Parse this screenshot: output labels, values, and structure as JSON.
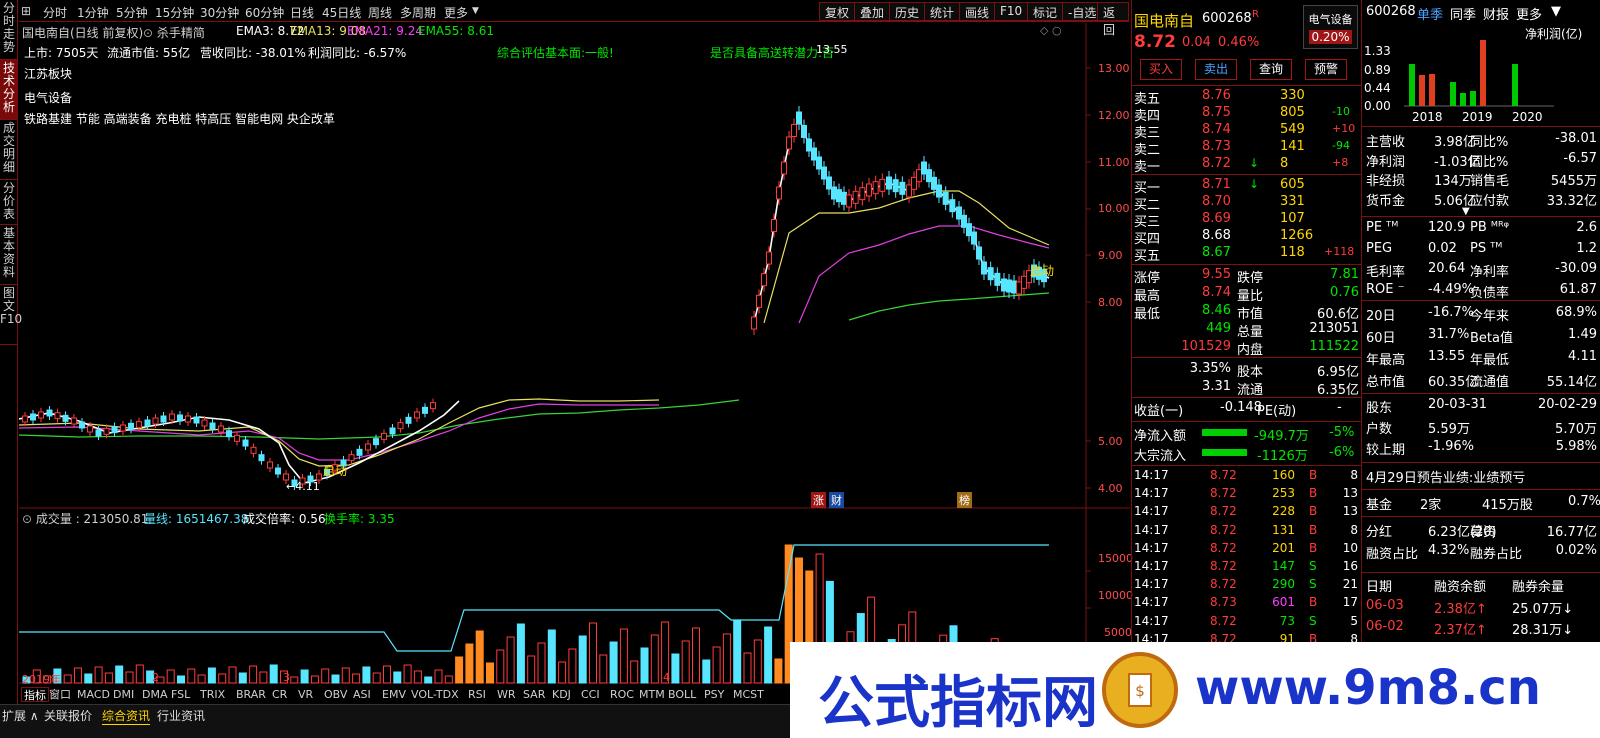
{
  "sidebar": {
    "tabs": [
      "分时走势",
      "技术分析",
      "成交明细",
      "分价表",
      "基本资料",
      "图文F10"
    ]
  },
  "toolbar": {
    "items": [
      "分时",
      "1分钟",
      "5分钟",
      "15分钟",
      "30分钟",
      "60分钟",
      "日线",
      "45日线",
      "周线",
      "多周期",
      "更多"
    ],
    "right": [
      "复权",
      "叠加",
      "历史",
      "统计",
      "画线",
      "F10",
      "标记",
      "-自选",
      "返回"
    ]
  },
  "chart": {
    "title": "国电南自(日线 前复权)",
    "indicator": "杀手精简",
    "ema3": "EMA3: 8.72",
    "ema13": "EMA13: 9.08",
    "ema21": "EMA21: 9.24",
    "ema55": "EMA55: 8.61",
    "listing": "上市: 7505天",
    "mcap": "流通市值: 55亿",
    "rev": "营收同比: -38.01%",
    "profit": "利润同比: -6.57%",
    "fund_eval": "综合评估基本面:一般!",
    "transfer_q": "是否具备高送转潜力:否",
    "blocks": [
      "江苏板块",
      "电气设备",
      "铁路基建 节能 高端装备 充电桩 特高压 智能电网 央企改革"
    ],
    "high_mark": "13.55",
    "low_mark": "4.11",
    "start1": "启动",
    "start2": "启动",
    "yticks": [
      "13.00",
      "12.00",
      "11.00",
      "10.00",
      "9.00",
      "8.00",
      "5.00",
      "4.00"
    ],
    "event_labels": [
      "涨",
      "财",
      "榜"
    ],
    "vol_title": "成交量 : 213050.81",
    "vol_ma": "量线: 1651467.38",
    "vol_ratio": "成交倍率: 0.56",
    "turnover": "换手率: 3.35",
    "vol_yticks": [
      "15000",
      "10000",
      "5000"
    ],
    "xlabels": [
      "2019年",
      "2",
      "3",
      "4"
    ]
  },
  "quote": {
    "name": "国电南自",
    "code": "600268",
    "flag": "R",
    "sector": "电气设备",
    "sector_chg": "0.20%",
    "price": "8.72",
    "chg": "0.04",
    "pct": "0.46%",
    "buttons": [
      "买入",
      "卖出",
      "查询",
      "预警"
    ],
    "asks": [
      {
        "l": "卖五",
        "p": "8.76",
        "v": "330",
        "d": ""
      },
      {
        "l": "卖四",
        "p": "8.75",
        "v": "805",
        "d": "-10"
      },
      {
        "l": "卖三",
        "p": "8.74",
        "v": "549",
        "d": "+10"
      },
      {
        "l": "卖二",
        "p": "8.73",
        "v": "141",
        "d": "-94"
      },
      {
        "l": "卖一",
        "p": "8.72",
        "v": "8",
        "d": "+8"
      }
    ],
    "bids": [
      {
        "l": "买一",
        "p": "8.71",
        "v": "605",
        "d": ""
      },
      {
        "l": "买二",
        "p": "8.70",
        "v": "331",
        "d": ""
      },
      {
        "l": "买三",
        "p": "8.69",
        "v": "107",
        "d": ""
      },
      {
        "l": "买四",
        "p": "8.68",
        "v": "1266",
        "d": ""
      },
      {
        "l": "买五",
        "p": "8.67",
        "v": "118",
        "d": "+118"
      }
    ],
    "stats": [
      [
        "涨停",
        "9.55",
        "跌停",
        "7.81"
      ],
      [
        "最高",
        "8.74",
        "量比",
        "0.76"
      ],
      [
        "最低",
        "8.46",
        "市值",
        "60.6亿"
      ],
      [
        "",
        "449",
        "总量",
        "213051"
      ],
      [
        "",
        "101529",
        "内盘",
        "111522"
      ]
    ],
    "stats2": [
      [
        "",
        "3.35%",
        "股本",
        "6.95亿"
      ],
      [
        "",
        "3.31",
        "流通",
        "6.35亿"
      ]
    ],
    "eps": [
      "收益(一)",
      "-0.148",
      "PE(动)",
      "-"
    ],
    "flows": [
      {
        "l": "净流入额",
        "v": "-949.7万",
        "p": "-5%"
      },
      {
        "l": "大宗流入",
        "v": "-1126万",
        "p": "-6%"
      }
    ],
    "ticks": [
      [
        "14:17",
        "8.72",
        "160",
        "B",
        "8"
      ],
      [
        "14:17",
        "8.72",
        "253",
        "B",
        "13"
      ],
      [
        "14:17",
        "8.72",
        "228",
        "B",
        "13"
      ],
      [
        "14:17",
        "8.72",
        "131",
        "B",
        "8"
      ],
      [
        "14:17",
        "8.72",
        "201",
        "B",
        "10"
      ],
      [
        "14:17",
        "8.72",
        "147",
        "S",
        "16"
      ],
      [
        "14:17",
        "8.72",
        "290",
        "S",
        "21"
      ],
      [
        "14:17",
        "8.73",
        "601",
        "B",
        "17"
      ],
      [
        "14:17",
        "8.72",
        "73",
        "S",
        "5"
      ],
      [
        "14:17",
        "8.72",
        "91",
        "B",
        "8"
      ]
    ]
  },
  "fund": {
    "code": "600268",
    "tabs": [
      "单季",
      "同季",
      "财报",
      "更多"
    ],
    "chart_title": "净利润(亿)",
    "years": [
      "2018",
      "2019",
      "2020"
    ],
    "yaxis": [
      "1.33",
      "0.89",
      "0.44",
      "0.00"
    ],
    "rows": [
      [
        "主营收",
        "3.98亿",
        "同比%",
        "-38.01"
      ],
      [
        "净利润",
        "-1.03亿",
        "同比%",
        "-6.57"
      ],
      [
        "非经损",
        "134万",
        "销售毛",
        "5455万"
      ],
      [
        "货币金",
        "5.06亿",
        "应付款",
        "33.32亿"
      ]
    ],
    "rows2": [
      [
        "PE ᵀᴹ",
        "120.9",
        "PB ᴹᴿᵠ",
        "2.6"
      ],
      [
        "PEG",
        "0.02",
        "PS ᵀᴹ",
        "1.2"
      ],
      [
        "毛利率",
        "20.64",
        "净利率",
        "-30.09"
      ],
      [
        "ROE ⁻",
        "-4.49%",
        "负债率",
        "61.87"
      ]
    ],
    "rows3": [
      [
        "20日",
        "-16.7%",
        "今年来",
        "68.9%"
      ],
      [
        "60日",
        "31.7%",
        "Beta值",
        "1.49"
      ],
      [
        "年最高",
        "13.55",
        "年最低",
        "4.11"
      ],
      [
        "总市值",
        "60.35亿",
        "流通值",
        "55.14亿"
      ]
    ],
    "rows4": [
      [
        "股东",
        "20-03-31",
        "",
        "20-02-29"
      ],
      [
        "户数",
        "5.59万",
        "",
        "5.70万"
      ],
      [
        "较上期",
        "-1.96%",
        "",
        "5.98%"
      ]
    ],
    "notice": "4月29日预告业绩:业绩预亏",
    "fundrow": [
      "基金",
      "2家",
      "415万股",
      "0.7%"
    ],
    "rows5": [
      [
        "分红",
        "6.23亿(20)",
        "募资",
        "16.77亿"
      ],
      [
        "融资占比",
        "4.32%",
        "融券占比",
        "0.02%"
      ]
    ],
    "margin_head": [
      "日期",
      "融资余额",
      "融券余量"
    ],
    "margin": [
      [
        "06-03",
        "2.38亿↑",
        "25.07万↓"
      ],
      [
        "06-02",
        "2.37亿↑",
        "28.31万↓"
      ]
    ]
  },
  "bottom": {
    "tabs": [
      "指标",
      "窗口",
      "MACD",
      "DMI",
      "DMA",
      "FSL",
      "TRIX",
      "BRAR",
      "CR",
      "VR",
      "OBV",
      "ASI",
      "EMV",
      "VOL-TDX",
      "RSI",
      "WR",
      "SAR",
      "KDJ",
      "CCI",
      "ROC",
      "MTM",
      "BOLL",
      "PSY",
      "MCST"
    ],
    "status": [
      "扩展 ∧",
      "关联报价",
      "综合资讯",
      "行业资讯"
    ]
  },
  "watermark": {
    "text": "公式指标网",
    "url": "www.9m8.cn",
    "sub": "www.9m8.cn"
  }
}
